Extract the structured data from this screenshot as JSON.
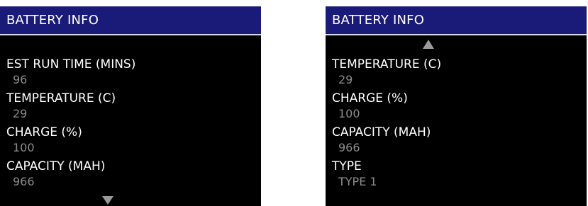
{
  "left_screen": {
    "title": "BATTERY INFO",
    "scroll_down_icon": "triangle-down",
    "items": [
      {
        "label": "EST RUN TIME (MINS)",
        "value": "96"
      },
      {
        "label": "TEMPERATURE (C)",
        "value": "29"
      },
      {
        "label": "CHARGE (%)",
        "value": "100"
      },
      {
        "label": "CAPACITY (MAH)",
        "value": "966"
      }
    ]
  },
  "right_screen": {
    "title": "BATTERY INFO",
    "scroll_up_icon": "triangle-up",
    "items": [
      {
        "label": "TEMPERATURE (C)",
        "value": "29"
      },
      {
        "label": "CHARGE (%)",
        "value": "100"
      },
      {
        "label": "CAPACITY (MAH)",
        "value": "966"
      },
      {
        "label": "TYPE",
        "value": "TYPE 1"
      }
    ]
  },
  "colors": {
    "title_bar": "#1a1a78",
    "screen_background": "#000000",
    "label_text": "#ffffff",
    "value_text": "#8c8c8c",
    "arrow": "#9a9a9a"
  }
}
